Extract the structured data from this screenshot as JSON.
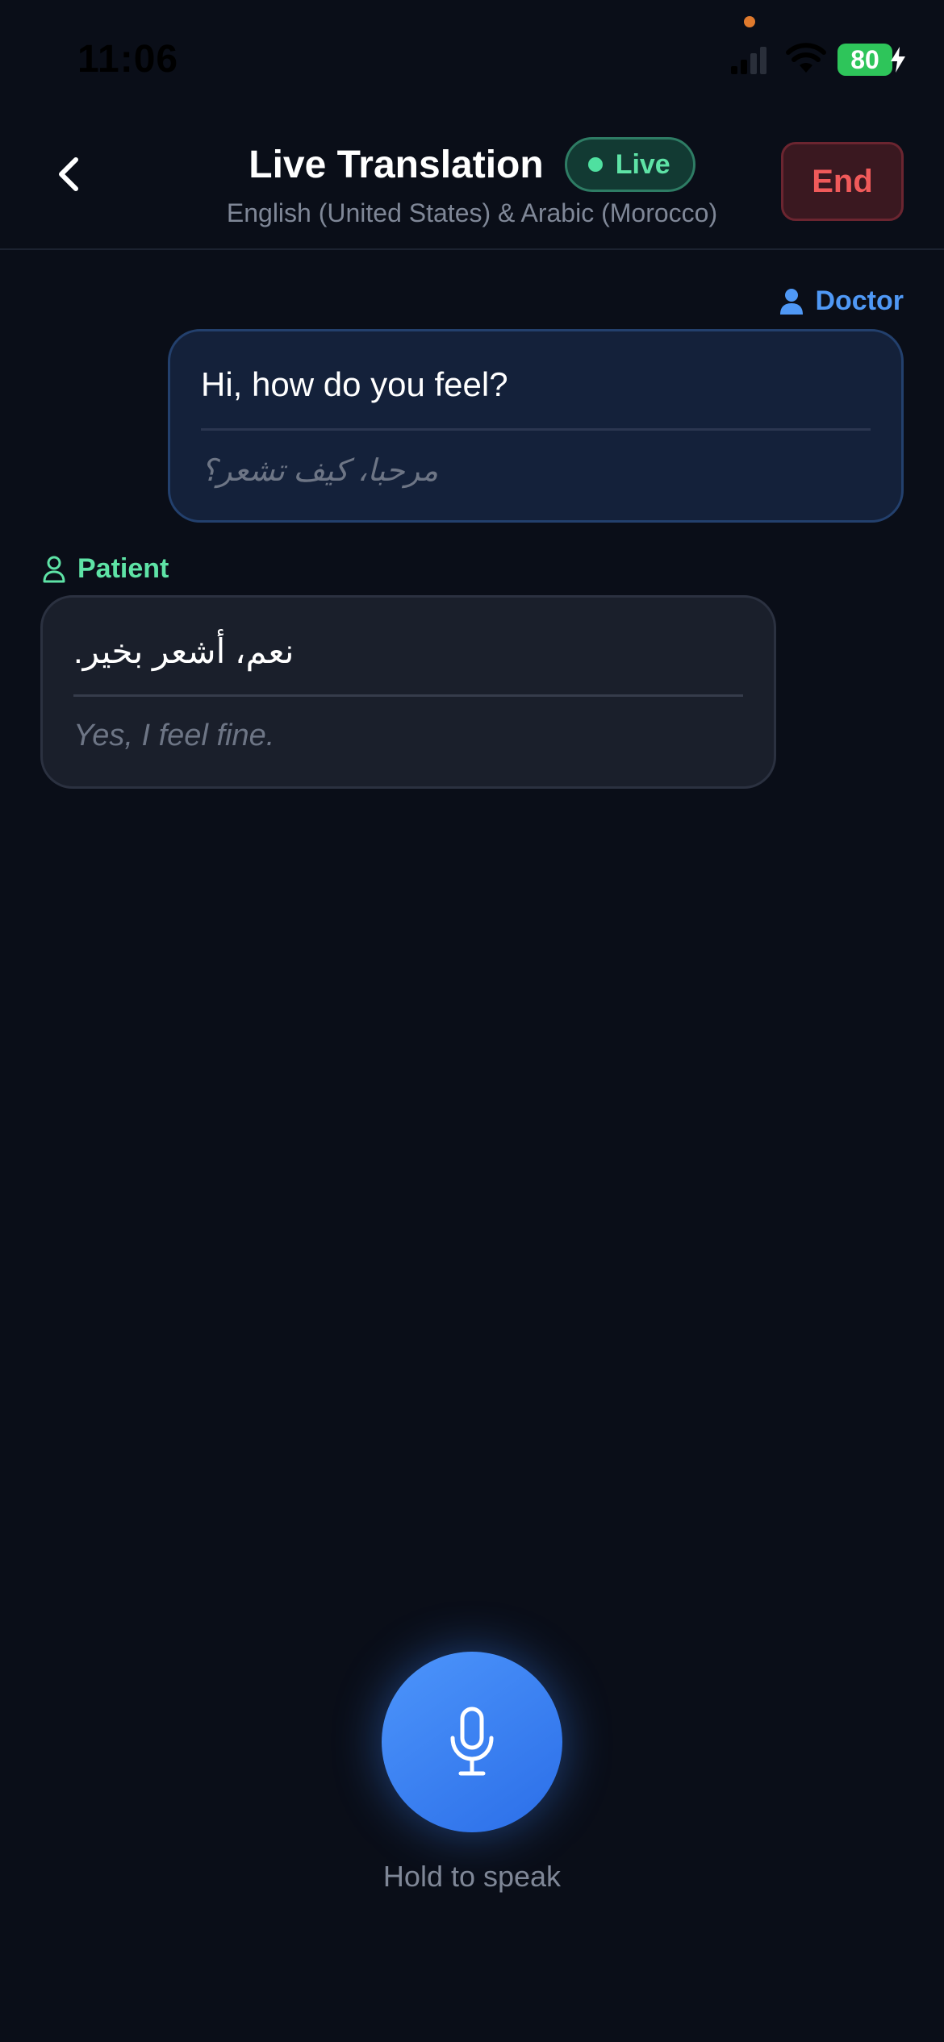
{
  "status_bar": {
    "time": "11:06",
    "battery_level": "80",
    "icons": [
      "signal-icon",
      "wifi-icon",
      "battery-icon",
      "charging-bolt-icon"
    ]
  },
  "header": {
    "back_icon": "chevron-left-icon",
    "title": "Live Translation",
    "live_badge": "Live",
    "subtitle": "English (United States) & Arabic (Morocco)",
    "end_label": "End"
  },
  "messages": [
    {
      "speaker": "Doctor",
      "speaker_icon": "person-filled-icon",
      "original": "Hi, how do you feel?",
      "translation": "مرحبا، كيف تشعر؟"
    },
    {
      "speaker": "Patient",
      "speaker_icon": "person-outline-icon",
      "original": "نعم، أشعر بخير.",
      "translation": "Yes, I feel fine."
    }
  ],
  "mic": {
    "icon": "microphone-icon",
    "label": "Hold to speak"
  },
  "colors": {
    "background": "#0a0e18",
    "doctor_accent": "#4f98f5",
    "patient_accent": "#5ee3a6",
    "end_red": "#f05a5a",
    "mic_blue": "#3b82f6"
  }
}
